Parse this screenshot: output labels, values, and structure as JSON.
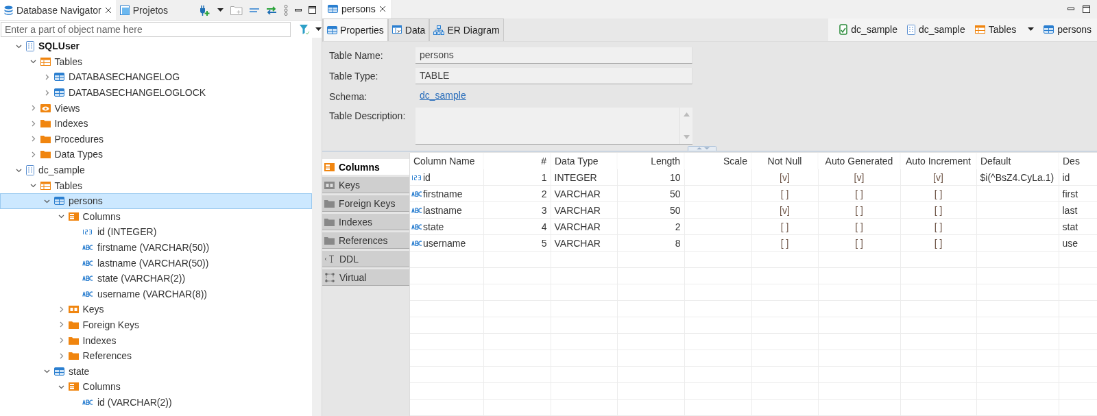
{
  "navigator": {
    "tabs": [
      {
        "label": "Database Navigator",
        "selected": true,
        "closable": true
      },
      {
        "label": "Projetos",
        "selected": false,
        "closable": false
      }
    ],
    "search": {
      "placeholder": "Enter a part of object name here"
    },
    "tree": [
      {
        "label": "SQLUser",
        "kind": "schema",
        "bold": true,
        "expanded": true,
        "selected": false,
        "children": [
          {
            "label": "Tables",
            "kind": "table-folder",
            "expanded": true,
            "selected": false,
            "children": [
              {
                "label": "DATABASECHANGELOG",
                "kind": "table",
                "expanded": false,
                "selected": false
              },
              {
                "label": "DATABASECHANGELOGLOCK",
                "kind": "table",
                "expanded": false,
                "selected": false
              }
            ]
          },
          {
            "label": "Views",
            "kind": "view-folder",
            "expanded": false,
            "selected": false
          },
          {
            "label": "Indexes",
            "kind": "folder",
            "expanded": false,
            "selected": false
          },
          {
            "label": "Procedures",
            "kind": "folder",
            "expanded": false,
            "selected": false
          },
          {
            "label": "Data Types",
            "kind": "folder",
            "expanded": false,
            "selected": false
          }
        ]
      },
      {
        "label": "dc_sample",
        "kind": "schema",
        "bold": false,
        "expanded": true,
        "selected": false,
        "children": [
          {
            "label": "Tables",
            "kind": "table-folder",
            "expanded": true,
            "selected": false,
            "children": [
              {
                "label": "persons",
                "kind": "table",
                "expanded": true,
                "selected": true,
                "children": [
                  {
                    "label": "Columns",
                    "kind": "column-folder",
                    "expanded": true,
                    "selected": false,
                    "children": [
                      {
                        "label": "id (INTEGER)",
                        "kind": "int-column",
                        "selected": false
                      },
                      {
                        "label": "firstname (VARCHAR(50))",
                        "kind": "text-column",
                        "selected": false
                      },
                      {
                        "label": "lastname (VARCHAR(50))",
                        "kind": "text-column",
                        "selected": false
                      },
                      {
                        "label": "state (VARCHAR(2))",
                        "kind": "text-column",
                        "selected": false
                      },
                      {
                        "label": "username (VARCHAR(8))",
                        "kind": "text-column",
                        "selected": false
                      }
                    ]
                  },
                  {
                    "label": "Keys",
                    "kind": "key-folder",
                    "expanded": false,
                    "selected": false
                  },
                  {
                    "label": "Foreign Keys",
                    "kind": "folder",
                    "expanded": false,
                    "selected": false
                  },
                  {
                    "label": "Indexes",
                    "kind": "folder",
                    "expanded": false,
                    "selected": false
                  },
                  {
                    "label": "References",
                    "kind": "folder",
                    "expanded": false,
                    "selected": false
                  }
                ]
              },
              {
                "label": "state",
                "kind": "table",
                "expanded": true,
                "selected": false,
                "children": [
                  {
                    "label": "Columns",
                    "kind": "column-folder",
                    "expanded": true,
                    "selected": false,
                    "children": [
                      {
                        "label": "id (VARCHAR(2))",
                        "kind": "text-column",
                        "selected": false
                      }
                    ]
                  }
                ]
              }
            ]
          }
        ]
      }
    ]
  },
  "editor": {
    "tab": {
      "label": "persons"
    },
    "subtabs": [
      {
        "label": "Properties",
        "kind": "table",
        "selected": true
      },
      {
        "label": "Data",
        "kind": "data",
        "selected": false
      },
      {
        "label": "ER Diagram",
        "kind": "diagram",
        "selected": false
      }
    ],
    "breadcrumb": [
      {
        "label": "dc_sample",
        "kind": "connection",
        "dropdown": false
      },
      {
        "label": "dc_sample",
        "kind": "schema",
        "dropdown": false
      },
      {
        "label": "Tables",
        "kind": "table-folder",
        "dropdown": true
      },
      {
        "label": "persons",
        "kind": "table",
        "dropdown": false
      }
    ],
    "properties": [
      {
        "label": "Table Name:",
        "kind": "field",
        "value": "persons"
      },
      {
        "label": "Table Type:",
        "kind": "field",
        "value": "TABLE"
      },
      {
        "label": "Schema:",
        "kind": "link",
        "value": "dc_sample"
      },
      {
        "label": "Table Description:",
        "kind": "textarea"
      }
    ],
    "side_tabs": [
      {
        "label": "Columns",
        "kind": "column-folder",
        "selected": true
      },
      {
        "label": "Keys",
        "kind": "key-folder",
        "selected": false
      },
      {
        "label": "Foreign Keys",
        "kind": "folder",
        "selected": false
      },
      {
        "label": "Indexes",
        "kind": "folder",
        "selected": false
      },
      {
        "label": "References",
        "kind": "folder",
        "selected": false
      },
      {
        "label": "DDL",
        "kind": "ddl",
        "selected": false
      },
      {
        "label": "Virtual",
        "kind": "virtual",
        "selected": false
      }
    ],
    "columns_table": {
      "columns": [
        "Column Name",
        "#",
        "Data Type",
        "Length",
        "Scale",
        "Not Null",
        "Auto Generated",
        "Auto Increment",
        "Default",
        "Des"
      ],
      "rows": [
        {
          "kind": "int",
          "cells": [
            "id",
            "1",
            "INTEGER",
            "10",
            "",
            "[v]",
            "[v]",
            "[v]",
            "$i(^BsZ4.CyLa.1)",
            "id"
          ]
        },
        {
          "kind": "text",
          "cells": [
            "firstname",
            "2",
            "VARCHAR",
            "50",
            "",
            "[ ]",
            "[ ]",
            "[ ]",
            "",
            "first"
          ]
        },
        {
          "kind": "text",
          "cells": [
            "lastname",
            "3",
            "VARCHAR",
            "50",
            "",
            "[v]",
            "[ ]",
            "[ ]",
            "",
            "last"
          ]
        },
        {
          "kind": "text",
          "cells": [
            "state",
            "4",
            "VARCHAR",
            "2",
            "",
            "[ ]",
            "[ ]",
            "[ ]",
            "",
            "stat"
          ]
        },
        {
          "kind": "text",
          "cells": [
            "username",
            "5",
            "VARCHAR",
            "8",
            "",
            "[ ]",
            "[ ]",
            "[ ]",
            "",
            "use"
          ]
        }
      ]
    }
  }
}
